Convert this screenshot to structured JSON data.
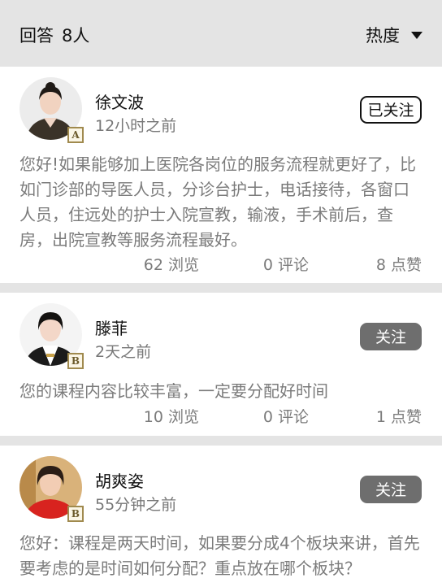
{
  "header": {
    "answers_label": "回答",
    "answers_count": "8人",
    "sort_label": "热度",
    "sort_icon": "triangle-down-icon"
  },
  "answers": [
    {
      "name": "徐文波",
      "time": "12小时之前",
      "level": "A",
      "follow_label": "已关注",
      "followed": true,
      "content": "您好!如果能够加上医院各岗位的服务流程就更好了，比如门诊部的导医人员，分诊台护士，电话接待，各窗口人员，住远处的护士入院宣教，输液，手术前后，查房，出院宣教等服务流程最好。",
      "views": "62 浏览",
      "comments": "0 评论",
      "likes": "8 点赞"
    },
    {
      "name": "滕菲",
      "time": "2天之前",
      "level": "B",
      "follow_label": "关注",
      "followed": false,
      "content": "您的课程内容比较丰富，一定要分配好时间",
      "views": "10 浏览",
      "comments": "0 评论",
      "likes": "1 点赞"
    },
    {
      "name": "胡爽姿",
      "time": "55分钟之前",
      "level": "B",
      "follow_label": "关注",
      "followed": false,
      "content": "您好：课程是两天时间，如果要分成4个板块来讲，首先要考虑的是时间如何分配？重点放在哪个板块？"
    }
  ],
  "colors": {
    "background": "#e4e4e4",
    "card": "#ffffff",
    "muted_text": "#7b7b7b",
    "follow_button": "#6e6e6e"
  }
}
